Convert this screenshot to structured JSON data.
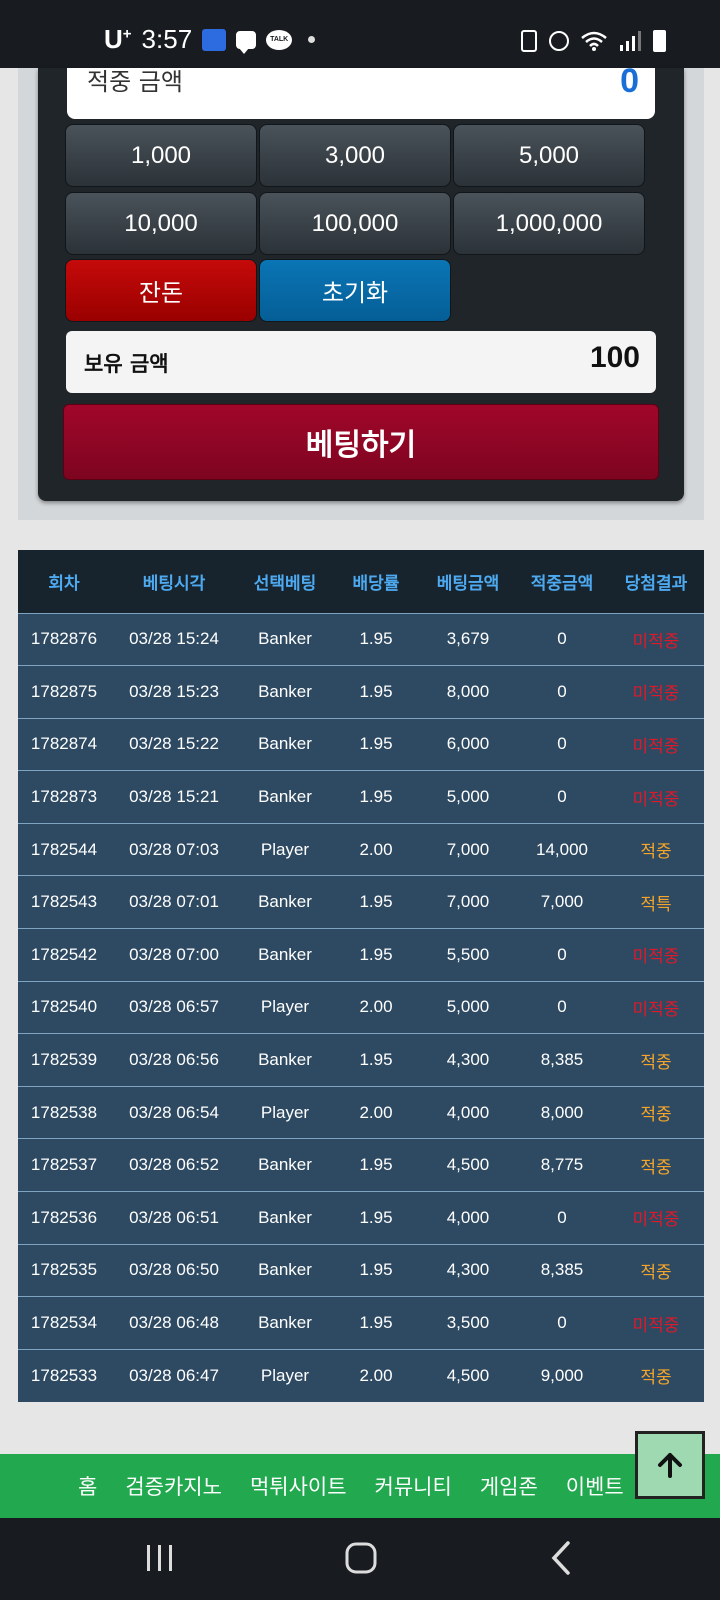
{
  "status_bar": {
    "carrier": "U",
    "carrier_sup": "+",
    "time": "3:57",
    "talk_label": "TALK",
    "icons": [
      "naver-app-icon",
      "chat-bubble-icon",
      "kakaotalk-icon",
      "notification-dot-icon",
      "recycle-icon",
      "alarm-icon",
      "wifi-icon",
      "signal-icon",
      "battery-icon"
    ]
  },
  "bet_panel": {
    "win_amount_label": "적중 금액",
    "win_amount_value": "0",
    "amount_buttons": [
      "1,000",
      "3,000",
      "5,000",
      "10,000",
      "100,000",
      "1,000,000"
    ],
    "change_button": "잔돈",
    "reset_button": "초기화",
    "holding_label": "보유 금액",
    "holding_value": "100",
    "bet_button": "베팅하기"
  },
  "history": {
    "columns": [
      "회차",
      "베팅시각",
      "선택베팅",
      "배당률",
      "베팅금액",
      "적중금액",
      "당첨결과"
    ],
    "rows": [
      {
        "round": "1782876",
        "time": "03/28 15:24",
        "pick": "Banker",
        "odds": "1.95",
        "bet": "3,679",
        "win": "0",
        "result": "미적중",
        "status": "lose"
      },
      {
        "round": "1782875",
        "time": "03/28 15:23",
        "pick": "Banker",
        "odds": "1.95",
        "bet": "8,000",
        "win": "0",
        "result": "미적중",
        "status": "lose"
      },
      {
        "round": "1782874",
        "time": "03/28 15:22",
        "pick": "Banker",
        "odds": "1.95",
        "bet": "6,000",
        "win": "0",
        "result": "미적중",
        "status": "lose"
      },
      {
        "round": "1782873",
        "time": "03/28 15:21",
        "pick": "Banker",
        "odds": "1.95",
        "bet": "5,000",
        "win": "0",
        "result": "미적중",
        "status": "lose"
      },
      {
        "round": "1782544",
        "time": "03/28 07:03",
        "pick": "Player",
        "odds": "2.00",
        "bet": "7,000",
        "win": "14,000",
        "result": "적중",
        "status": "win"
      },
      {
        "round": "1782543",
        "time": "03/28 07:01",
        "pick": "Banker",
        "odds": "1.95",
        "bet": "7,000",
        "win": "7,000",
        "result": "적특",
        "status": "win"
      },
      {
        "round": "1782542",
        "time": "03/28 07:00",
        "pick": "Banker",
        "odds": "1.95",
        "bet": "5,500",
        "win": "0",
        "result": "미적중",
        "status": "lose"
      },
      {
        "round": "1782540",
        "time": "03/28 06:57",
        "pick": "Player",
        "odds": "2.00",
        "bet": "5,000",
        "win": "0",
        "result": "미적중",
        "status": "lose"
      },
      {
        "round": "1782539",
        "time": "03/28 06:56",
        "pick": "Banker",
        "odds": "1.95",
        "bet": "4,300",
        "win": "8,385",
        "result": "적중",
        "status": "win"
      },
      {
        "round": "1782538",
        "time": "03/28 06:54",
        "pick": "Player",
        "odds": "2.00",
        "bet": "4,000",
        "win": "8,000",
        "result": "적중",
        "status": "win"
      },
      {
        "round": "1782537",
        "time": "03/28 06:52",
        "pick": "Banker",
        "odds": "1.95",
        "bet": "4,500",
        "win": "8,775",
        "result": "적중",
        "status": "win"
      },
      {
        "round": "1782536",
        "time": "03/28 06:51",
        "pick": "Banker",
        "odds": "1.95",
        "bet": "4,000",
        "win": "0",
        "result": "미적중",
        "status": "lose"
      },
      {
        "round": "1782535",
        "time": "03/28 06:50",
        "pick": "Banker",
        "odds": "1.95",
        "bet": "4,300",
        "win": "8,385",
        "result": "적중",
        "status": "win"
      },
      {
        "round": "1782534",
        "time": "03/28 06:48",
        "pick": "Banker",
        "odds": "1.95",
        "bet": "3,500",
        "win": "0",
        "result": "미적중",
        "status": "lose"
      },
      {
        "round": "1782533",
        "time": "03/28 06:47",
        "pick": "Player",
        "odds": "2.00",
        "bet": "4,500",
        "win": "9,000",
        "result": "적중",
        "status": "win"
      }
    ]
  },
  "bottom_nav": {
    "items": [
      "홈",
      "검증카지노",
      "먹튀사이트",
      "커뮤니티",
      "게임존",
      "이벤트"
    ]
  },
  "colors": {
    "win_value": "#1a6fd6",
    "result_lose": "#e0182a",
    "result_win": "#f4a52a",
    "nav_green": "#22a84f",
    "header_text": "#4eaaf0"
  }
}
